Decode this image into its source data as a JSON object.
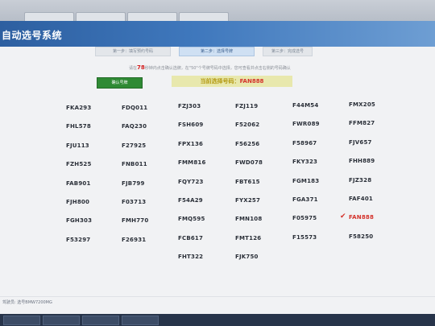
{
  "window": {
    "app_title": "自动选号系统"
  },
  "steps": {
    "step1": "第一步：填写预约号码",
    "step2": "第二步：选择号牌",
    "step3": "第三步：完成选号"
  },
  "hint": {
    "prefix": "请在",
    "seconds": "78",
    "suffix": "秒钟内点击确认选牌，在\"50\"个号牌号码中选择，您可查看并点击右侧的号码确认"
  },
  "actions": {
    "confirm_label": "确认号牌"
  },
  "current": {
    "label": "当前选择号码：",
    "value": "FAN888"
  },
  "plates": {
    "col1": [
      "FKA293",
      "FHL578",
      "FJU113",
      "FZH525",
      "FAB901",
      "FJH800",
      "FGH303",
      "F53297"
    ],
    "col2": [
      "FDQ011",
      "FAQ230",
      "F27925",
      "FNB011",
      "FJB799",
      "F03713",
      "FMH770",
      "F26931"
    ],
    "col3": [
      "FZJ303",
      "FSH609",
      "FPX136",
      "FMM816",
      "FQY723",
      "F54A29",
      "FMQ595",
      "FCB617",
      "FHT322"
    ],
    "col4": [
      "FZJ119",
      "F52062",
      "F56256",
      "FWD078",
      "FBT615",
      "FYX257",
      "FMN108",
      "FMT126",
      "FJK750"
    ],
    "col5": [
      "F44M54",
      "FWR089",
      "F58967",
      "FKY323",
      "FGM183",
      "FGA371",
      "F05975",
      "F15573"
    ],
    "col6": [
      "FMX205",
      "FFM827",
      "FJV657",
      "FHH889",
      "FJZ328",
      "FAF401",
      "FAN888",
      "F58250"
    ]
  },
  "selected_plate": "FAN888",
  "status_bar": {
    "text": "驾驶员: 选号BMW7200MG"
  },
  "colors": {
    "accent_red": "#d4322b",
    "confirm_green": "#2f8a34",
    "header_blue": "#2d5fa0"
  }
}
